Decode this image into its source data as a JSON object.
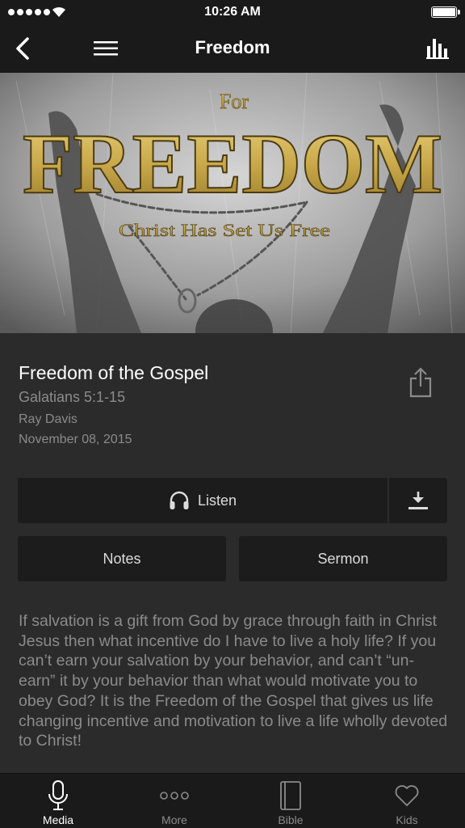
{
  "status_bar": {
    "time": "10:26 AM",
    "signal_icon": "signal-dots-icon",
    "wifi_icon": "wifi-icon",
    "battery_icon": "battery-icon",
    "battery_level": 1.0
  },
  "nav": {
    "title": "Freedom",
    "back_icon": "chevron-left-icon",
    "menu_icon": "hamburger-menu-icon",
    "stats_icon": "bar-chart-icon"
  },
  "hero": {
    "for_text": "For",
    "title_text": "FREEDOM",
    "subtitle_text": "Christ Has Set Us Free"
  },
  "sermon": {
    "title": "Freedom of the Gospel",
    "scripture": "Galatians 5:1-15",
    "speaker": "Ray Davis",
    "date": "November 08, 2015",
    "share_icon": "share-icon"
  },
  "actions": {
    "listen_label": "Listen",
    "listen_icon": "headphones-icon",
    "download_icon": "download-icon",
    "notes_label": "Notes",
    "sermon_label": "Sermon"
  },
  "description": "If salvation is a gift from God by grace through faith in Christ Jesus then what incentive do I have to live a holy life? If you can’t earn your salvation by your behavior, and can’t “un-earn” it by your behavior than what would motivate you to obey God? It is the Freedom of the Gospel that gives us life changing incentive and motivation to live a life wholly devoted to Christ!",
  "tabs": [
    {
      "label": "Media",
      "icon": "microphone-icon",
      "active": true
    },
    {
      "label": "More",
      "icon": "more-dots-icon",
      "active": false
    },
    {
      "label": "Bible",
      "icon": "book-icon",
      "active": false
    },
    {
      "label": "Kids",
      "icon": "heart-icon",
      "active": false
    }
  ],
  "colors": {
    "background": "#2b2b2b",
    "bar_background": "#1a1a1a",
    "button_background": "#1c1c1c",
    "muted_text": "#8b8b8b",
    "hero_gold": "#c9a94a"
  }
}
